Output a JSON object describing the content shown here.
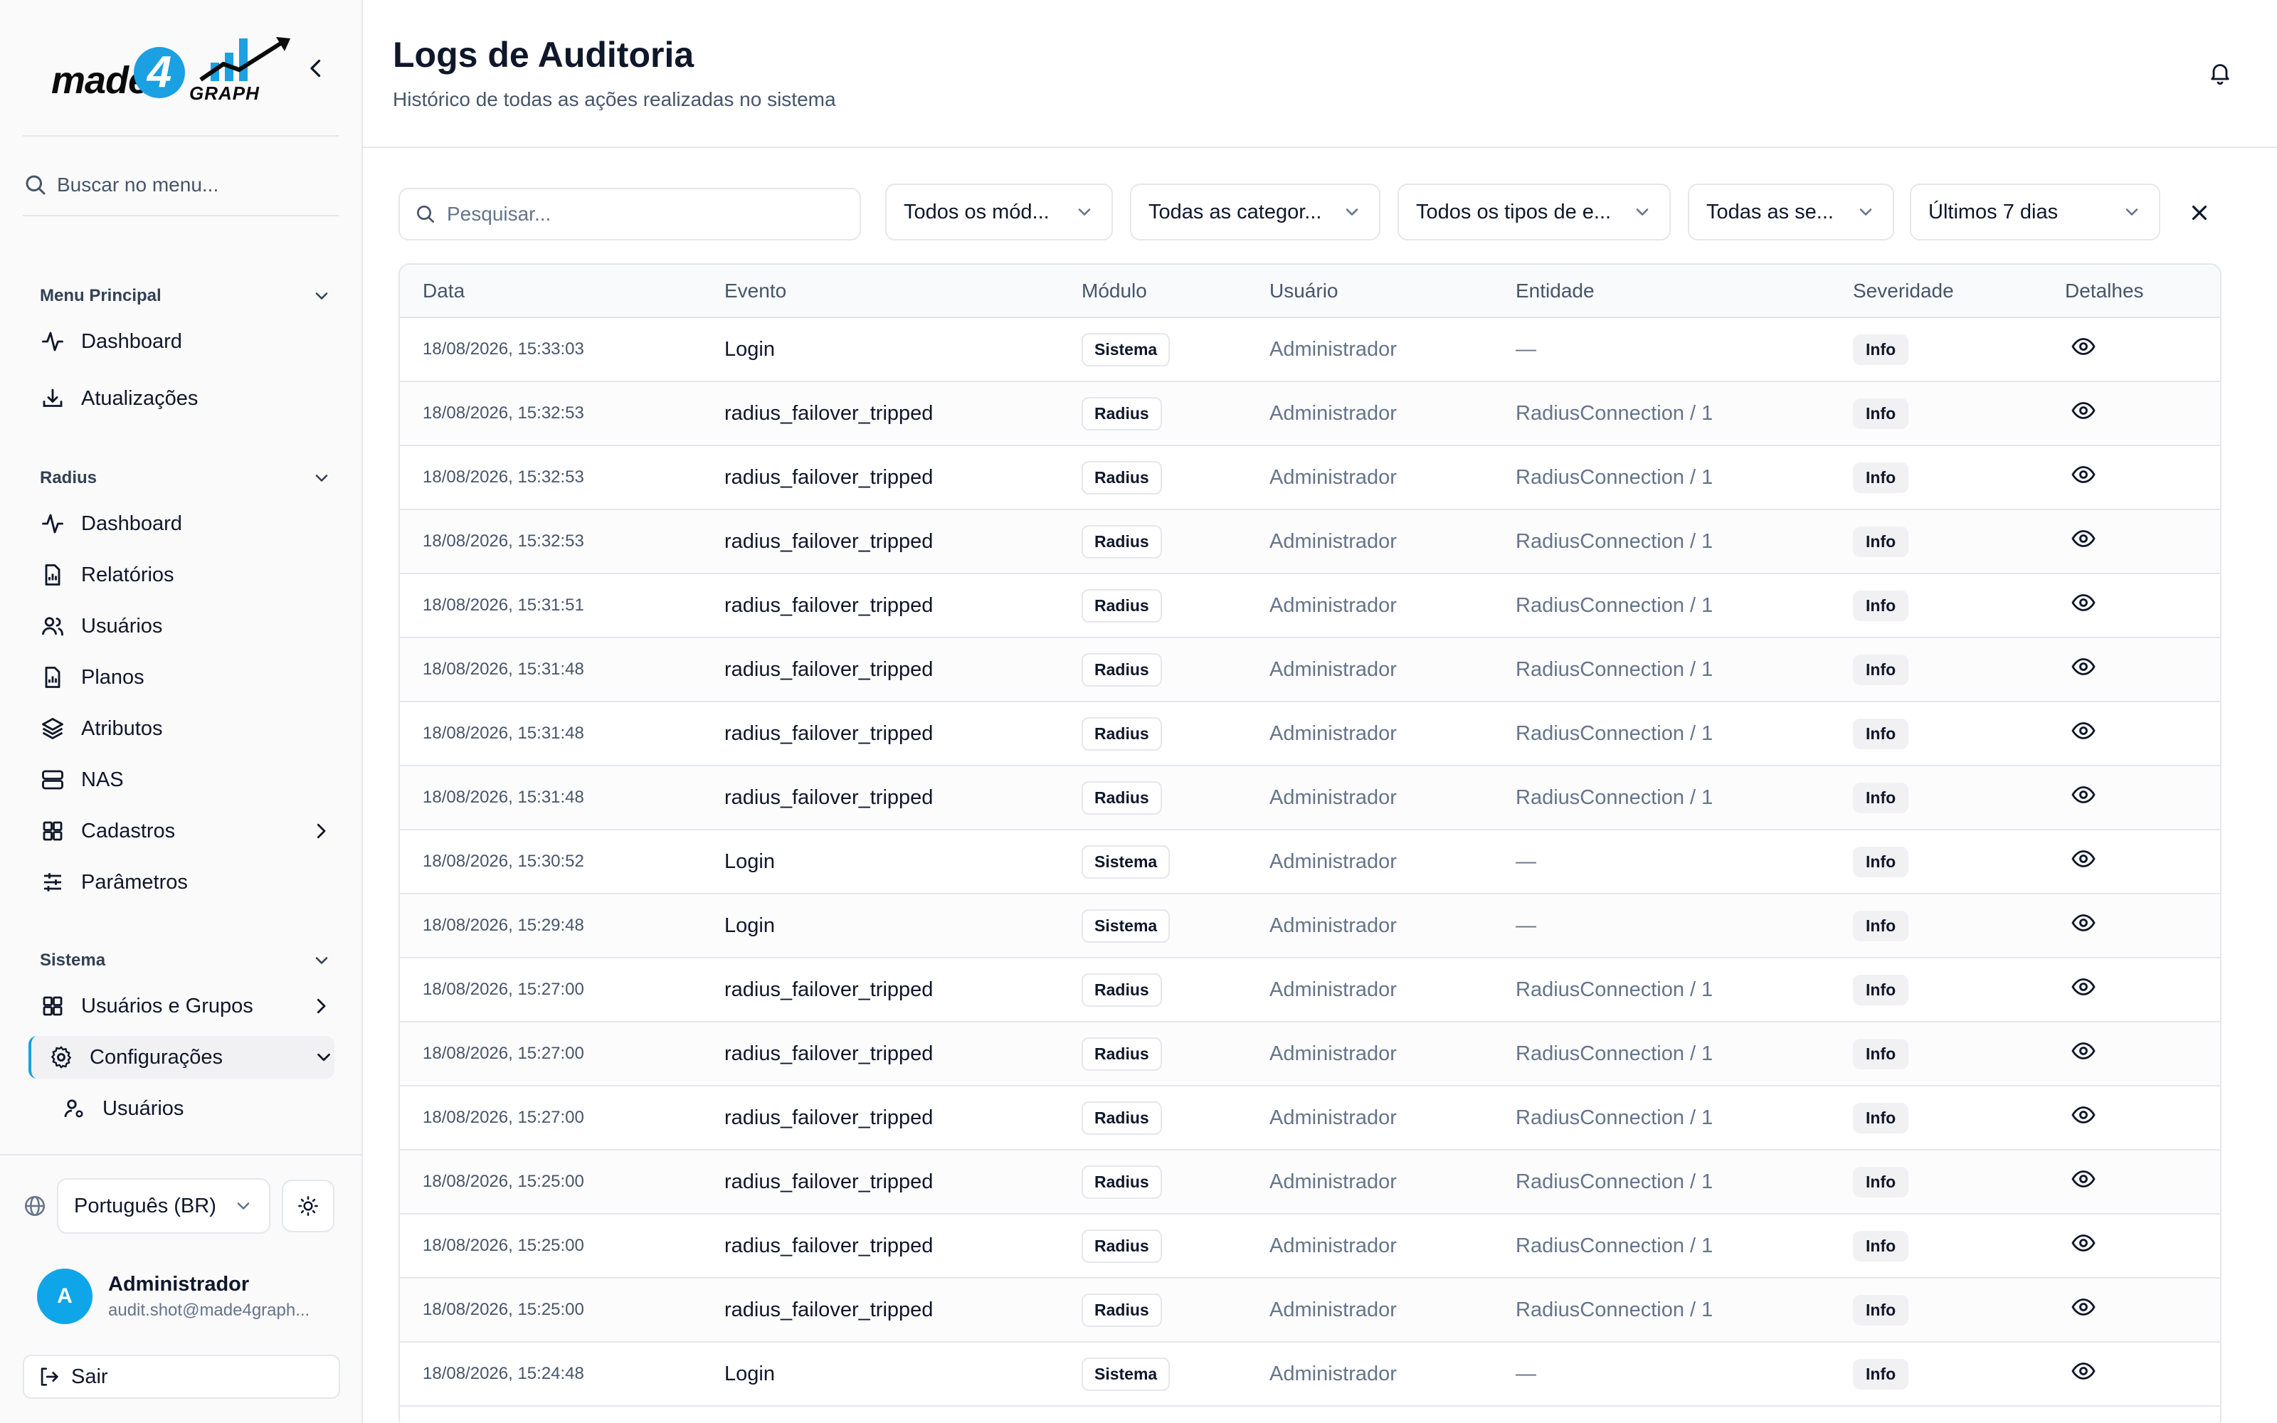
{
  "sidebar": {
    "logo": {
      "text": "made",
      "four": "4",
      "graph": "GRAPH"
    },
    "search_placeholder": "Buscar no menu...",
    "sections": [
      {
        "title": "Menu Principal",
        "items": [
          "Dashboard",
          "Atualizações"
        ]
      },
      {
        "title": "Radius",
        "items": [
          "Dashboard",
          "Relatórios",
          "Usuários",
          "Planos",
          "Atributos",
          "NAS",
          "Cadastros",
          "Parâmetros"
        ]
      },
      {
        "title": "Sistema",
        "items": [
          "Usuários e Grupos",
          "Configurações",
          "Usuários"
        ]
      }
    ],
    "language": "Português (BR)",
    "user": {
      "initial": "A",
      "name": "Administrador",
      "email": "audit.shot@made4graph..."
    },
    "logout": "Sair"
  },
  "header": {
    "title": "Logs de Auditoria",
    "subtitle": "Histórico de todas as ações realizadas no sistema"
  },
  "filters": {
    "search_placeholder": "Pesquisar...",
    "modules": "Todos os mód...",
    "categories": "Todas as categor...",
    "event_types": "Todos os tipos de e...",
    "severities": "Todas as se...",
    "period": "Últimos 7 dias"
  },
  "table": {
    "columns": [
      "Data",
      "Evento",
      "Módulo",
      "Usuário",
      "Entidade",
      "Severidade",
      "Detalhes"
    ],
    "rows": [
      {
        "date": "18/08/2026, 15:33:03",
        "event": "Login",
        "module": "Sistema",
        "user": "Administrador",
        "entity": "—",
        "severity": "Info"
      },
      {
        "date": "18/08/2026, 15:32:53",
        "event": "radius_failover_tripped",
        "module": "Radius",
        "user": "Administrador",
        "entity": "RadiusConnection / 1",
        "severity": "Info"
      },
      {
        "date": "18/08/2026, 15:32:53",
        "event": "radius_failover_tripped",
        "module": "Radius",
        "user": "Administrador",
        "entity": "RadiusConnection / 1",
        "severity": "Info"
      },
      {
        "date": "18/08/2026, 15:32:53",
        "event": "radius_failover_tripped",
        "module": "Radius",
        "user": "Administrador",
        "entity": "RadiusConnection / 1",
        "severity": "Info"
      },
      {
        "date": "18/08/2026, 15:31:51",
        "event": "radius_failover_tripped",
        "module": "Radius",
        "user": "Administrador",
        "entity": "RadiusConnection / 1",
        "severity": "Info"
      },
      {
        "date": "18/08/2026, 15:31:48",
        "event": "radius_failover_tripped",
        "module": "Radius",
        "user": "Administrador",
        "entity": "RadiusConnection / 1",
        "severity": "Info"
      },
      {
        "date": "18/08/2026, 15:31:48",
        "event": "radius_failover_tripped",
        "module": "Radius",
        "user": "Administrador",
        "entity": "RadiusConnection / 1",
        "severity": "Info"
      },
      {
        "date": "18/08/2026, 15:31:48",
        "event": "radius_failover_tripped",
        "module": "Radius",
        "user": "Administrador",
        "entity": "RadiusConnection / 1",
        "severity": "Info"
      },
      {
        "date": "18/08/2026, 15:30:52",
        "event": "Login",
        "module": "Sistema",
        "user": "Administrador",
        "entity": "—",
        "severity": "Info"
      },
      {
        "date": "18/08/2026, 15:29:48",
        "event": "Login",
        "module": "Sistema",
        "user": "Administrador",
        "entity": "—",
        "severity": "Info"
      },
      {
        "date": "18/08/2026, 15:27:00",
        "event": "radius_failover_tripped",
        "module": "Radius",
        "user": "Administrador",
        "entity": "RadiusConnection / 1",
        "severity": "Info"
      },
      {
        "date": "18/08/2026, 15:27:00",
        "event": "radius_failover_tripped",
        "module": "Radius",
        "user": "Administrador",
        "entity": "RadiusConnection / 1",
        "severity": "Info"
      },
      {
        "date": "18/08/2026, 15:27:00",
        "event": "radius_failover_tripped",
        "module": "Radius",
        "user": "Administrador",
        "entity": "RadiusConnection / 1",
        "severity": "Info"
      },
      {
        "date": "18/08/2026, 15:25:00",
        "event": "radius_failover_tripped",
        "module": "Radius",
        "user": "Administrador",
        "entity": "RadiusConnection / 1",
        "severity": "Info"
      },
      {
        "date": "18/08/2026, 15:25:00",
        "event": "radius_failover_tripped",
        "module": "Radius",
        "user": "Administrador",
        "entity": "RadiusConnection / 1",
        "severity": "Info"
      },
      {
        "date": "18/08/2026, 15:25:00",
        "event": "radius_failover_tripped",
        "module": "Radius",
        "user": "Administrador",
        "entity": "RadiusConnection / 1",
        "severity": "Info"
      },
      {
        "date": "18/08/2026, 15:24:48",
        "event": "Login",
        "module": "Sistema",
        "user": "Administrador",
        "entity": "—",
        "severity": "Info"
      }
    ]
  },
  "colors": {
    "accent": "#1ba0e2",
    "avatar": "#0ea5e9"
  }
}
